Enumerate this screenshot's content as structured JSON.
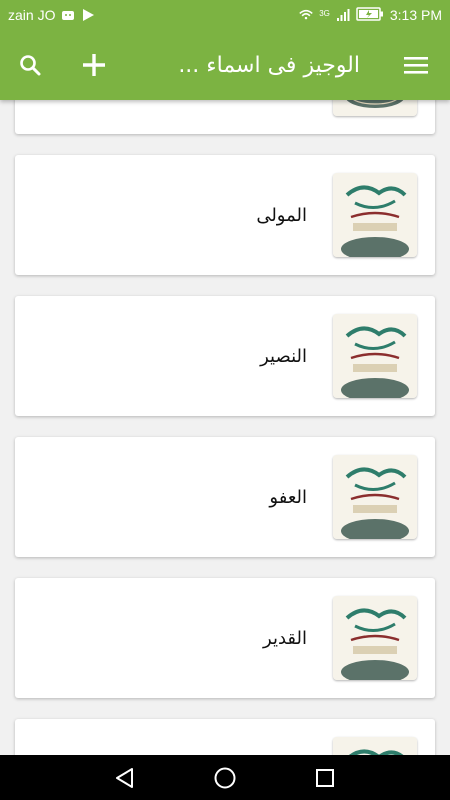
{
  "status_bar": {
    "carrier": "zain JO",
    "network": "3G",
    "time": "3:13 PM"
  },
  "app_bar": {
    "title": "الوجيز فى اسماء ...",
    "color": "#7cb342"
  },
  "list": {
    "items": [
      {
        "name": ""
      },
      {
        "name": "المولى"
      },
      {
        "name": "النصير"
      },
      {
        "name": "العفو"
      },
      {
        "name": "القدير"
      },
      {
        "name": ""
      }
    ]
  },
  "icons": {
    "search": "search-icon",
    "add": "plus-icon",
    "menu": "hamburger-menu-icon",
    "back": "back-triangle-icon",
    "home": "home-circle-icon",
    "recents": "recents-square-icon"
  }
}
